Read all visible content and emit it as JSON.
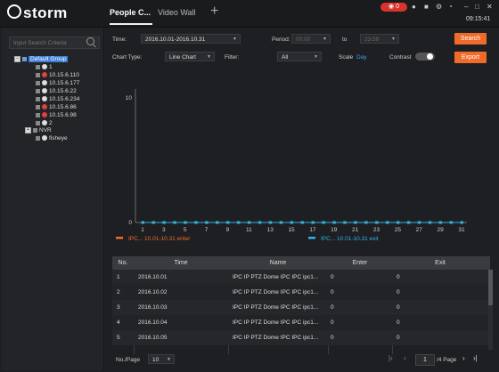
{
  "app": {
    "logo": "storm",
    "tabs": [
      "People C...",
      "Video Wall"
    ],
    "add_tab": "+",
    "alarm_count": "0",
    "clock": "09:15:41"
  },
  "sidebar": {
    "search_placeholder": "Input Search Criteria",
    "tree": [
      {
        "label": "Default Group",
        "level": 0,
        "type": "group",
        "selected": true
      },
      {
        "label": "1",
        "level": 1,
        "type": "cam",
        "color": "white"
      },
      {
        "label": "10.15.6.110",
        "level": 1,
        "type": "cam",
        "color": "red"
      },
      {
        "label": "10.15.6.177",
        "level": 1,
        "type": "cam",
        "color": "white"
      },
      {
        "label": "10.15.6.22",
        "level": 1,
        "type": "cam",
        "color": "white"
      },
      {
        "label": "10.15.6.234",
        "level": 1,
        "type": "cam",
        "color": "white"
      },
      {
        "label": "10.15.6.86",
        "level": 1,
        "type": "cam",
        "color": "red"
      },
      {
        "label": "10.15.6.98",
        "level": 1,
        "type": "cam",
        "color": "red"
      },
      {
        "label": "2",
        "level": 1,
        "type": "cam",
        "color": "white"
      },
      {
        "label": "NVR",
        "level": 0,
        "type": "nvr"
      },
      {
        "label": "fisheye",
        "level": 0,
        "type": "cam",
        "color": "white"
      }
    ]
  },
  "toolbar": {
    "time_label": "Time:",
    "time_value": "2016.10.01-2016.10.31",
    "period_label": "Period:",
    "period_from": "00:00",
    "to_label": "to",
    "period_to": "23:59",
    "search_label": "Search",
    "chart_type_label": "Chart Type:",
    "chart_type_value": "Line Chart",
    "filter_label": "Filter:",
    "filter_value": "All",
    "scale_label": "Scale",
    "scale_value": "Day",
    "contrast_label": "Contrast",
    "export_label": "Export"
  },
  "chart_data": {
    "type": "line",
    "x": [
      1,
      2,
      3,
      4,
      5,
      6,
      7,
      8,
      9,
      10,
      11,
      12,
      13,
      14,
      15,
      16,
      17,
      18,
      19,
      20,
      21,
      22,
      23,
      24,
      25,
      26,
      27,
      28,
      29,
      30,
      31
    ],
    "xticks": [
      "1",
      "3",
      "5",
      "7",
      "9",
      "11",
      "13",
      "15",
      "17",
      "19",
      "21",
      "23",
      "25",
      "27",
      "29",
      "31"
    ],
    "yticks": [
      "0",
      "10"
    ],
    "ylim": [
      0,
      10
    ],
    "series": [
      {
        "name": "IPC...  10.01-10.31 enter",
        "color": "#f06b2a",
        "values": [
          0,
          0,
          0,
          0,
          0,
          0,
          0,
          0,
          0,
          0,
          0,
          0,
          0,
          0,
          0,
          0,
          0,
          0,
          0,
          0,
          0,
          0,
          0,
          0,
          0,
          0,
          0,
          0,
          0,
          0,
          0
        ]
      },
      {
        "name": "IPC...  10.01-10.31 exit",
        "color": "#29b6e8",
        "values": [
          0,
          0,
          0,
          0,
          0,
          0,
          0,
          0,
          0,
          0,
          0,
          0,
          0,
          0,
          0,
          0,
          0,
          0,
          0,
          0,
          0,
          0,
          0,
          0,
          0,
          0,
          0,
          0,
          0,
          0,
          0
        ]
      }
    ]
  },
  "table": {
    "headers": [
      "No.",
      "Time",
      "Name",
      "Enter",
      "Exit"
    ],
    "rows": [
      [
        "1",
        "2016.10.01",
        "IPC IP PTZ Dome IPC IPC ipc1...",
        "0",
        "0"
      ],
      [
        "2",
        "2016.10.02",
        "IPC IP PTZ Dome IPC IPC ipc1...",
        "0",
        "0"
      ],
      [
        "3",
        "2016.10.03",
        "IPC IP PTZ Dome IPC IPC ipc1...",
        "0",
        "0"
      ],
      [
        "4",
        "2016.10.04",
        "IPC IP PTZ Dome IPC IPC ipc1...",
        "0",
        "0"
      ],
      [
        "5",
        "2016.10.05",
        "IPC IP PTZ Dome IPC IPC ipc1...",
        "0",
        "0"
      ]
    ]
  },
  "footer": {
    "per_page_label": "No./Page",
    "per_page_value": "10",
    "page_value": "1",
    "page_total": "/4 Page"
  }
}
